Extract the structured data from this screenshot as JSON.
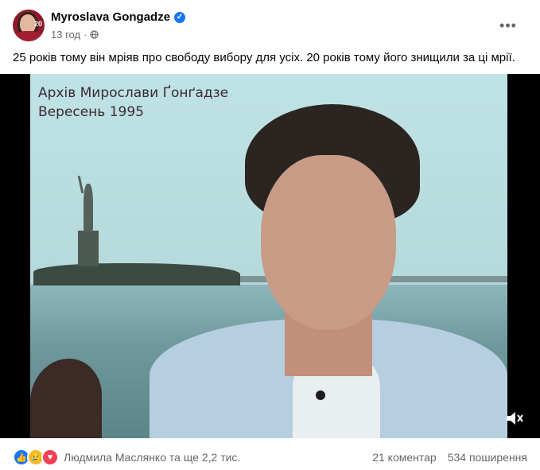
{
  "author": {
    "name": "Myroslava Gongadze",
    "avatar_badge": "20"
  },
  "post": {
    "time": "13 год",
    "separator": "·",
    "text": "25 років тому він мріяв про свободу вибору для усіх. 20 років тому його знищили за ці мрії.",
    "more_label": "•••"
  },
  "video": {
    "overlay_line1": "Архів Мирослави Ґонґадзе",
    "overlay_line2": "Вересень 1995"
  },
  "reactions": {
    "icons": [
      "like-icon",
      "sad-icon",
      "love-icon"
    ],
    "names": "Людмила Маслянко та ще 2,2 тис.",
    "comments": "21 коментар",
    "shares": "534 поширення"
  },
  "colors": {
    "accent": "#1877f2",
    "secondary_text": "#65676b",
    "love": "#f33e58",
    "sad": "#f7b928"
  }
}
